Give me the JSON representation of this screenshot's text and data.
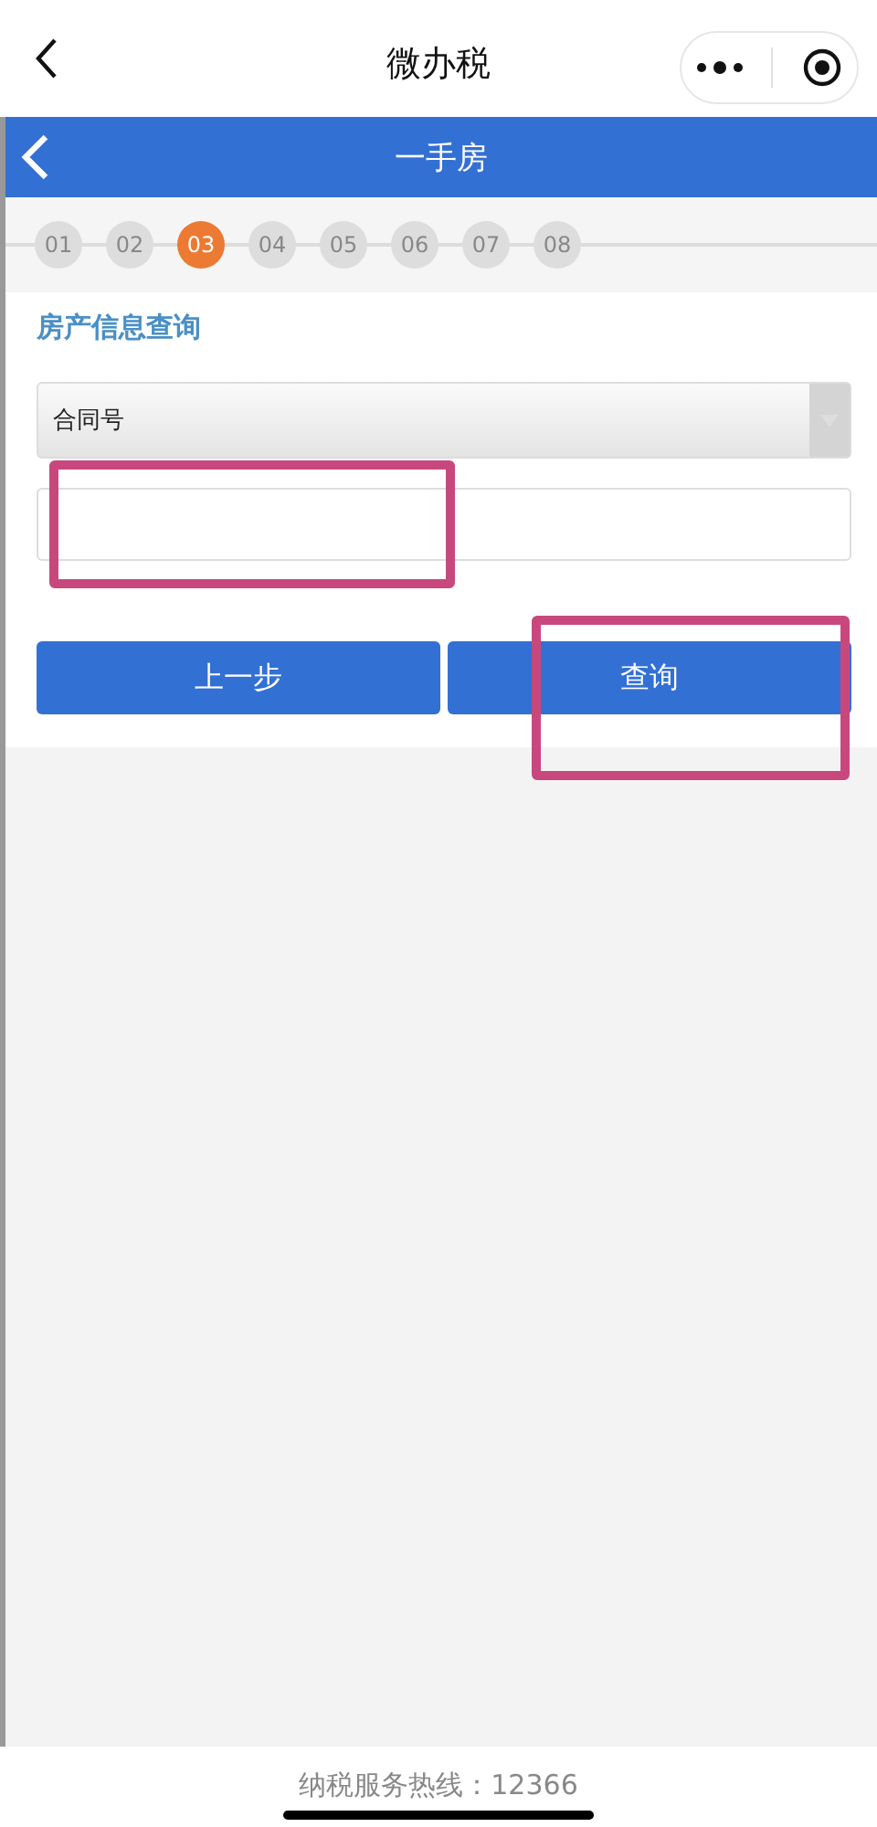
{
  "top_bar": {
    "title": "微办税"
  },
  "header": {
    "title": "一手房"
  },
  "steps": [
    {
      "label": "01",
      "selected": false
    },
    {
      "label": "02",
      "selected": false
    },
    {
      "label": "03",
      "selected": true
    },
    {
      "label": "04",
      "selected": false
    },
    {
      "label": "05",
      "selected": false
    },
    {
      "label": "06",
      "selected": false
    },
    {
      "label": "07",
      "selected": false
    },
    {
      "label": "08",
      "selected": false
    }
  ],
  "section": {
    "title": "房产信息查询"
  },
  "select": {
    "value": "合同号"
  },
  "buttons": [
    "上一步",
    "查询"
  ],
  "footer": {
    "text": "纳税服务热线：12366"
  }
}
